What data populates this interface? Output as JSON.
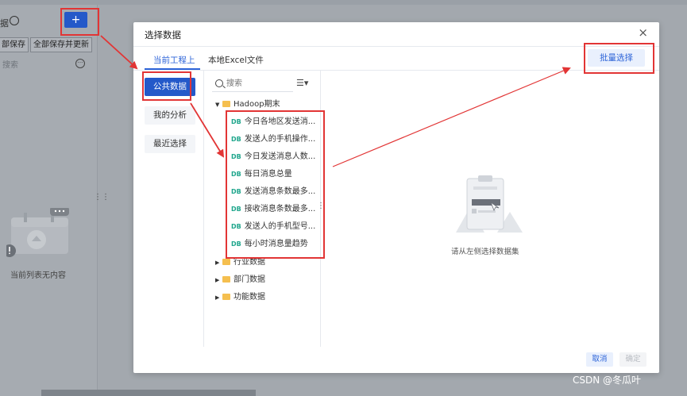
{
  "background": {
    "title_fragment": "据",
    "add_button": "+",
    "save_button_partial": "部保存",
    "save_all_update_button": "全部保存并更新",
    "search_placeholder": "搜索",
    "empty_list_text": "当前列表无内容"
  },
  "dialog": {
    "title": "选择数据",
    "close": "×",
    "tabs": [
      {
        "label": "当前工程上",
        "active": true
      },
      {
        "label": "本地Excel文件",
        "active": false
      }
    ],
    "batch_select": "批量选择",
    "categories": [
      {
        "label": "公共数据",
        "active": true
      },
      {
        "label": "我的分析",
        "active": false
      },
      {
        "label": "最近选择",
        "active": false
      }
    ],
    "search": {
      "placeholder": "搜索"
    },
    "tree": {
      "expanded_folder": "Hadoop期末",
      "datasets": [
        "今日各地区发送消...",
        "发送人的手机操作...",
        "今日发送消息人数...",
        "每日消息总量",
        "发送消息条数最多...",
        "接收消息条数最多...",
        "发送人的手机型号...",
        "每小时消息量趋势"
      ],
      "collapsed_folders": [
        "行业数据",
        "部门数据",
        "功能数据"
      ],
      "db_tag": "DB"
    },
    "empty_hint": "请从左侧选择数据集",
    "footer": {
      "cancel": "取消",
      "ok": "确定"
    }
  },
  "watermark": "CSDN @冬瓜叶",
  "colors": {
    "accent": "#2d64d8",
    "annotation_red": "#e23535",
    "db_green": "#1fa68c",
    "folder_yellow": "#f5bf4f"
  }
}
